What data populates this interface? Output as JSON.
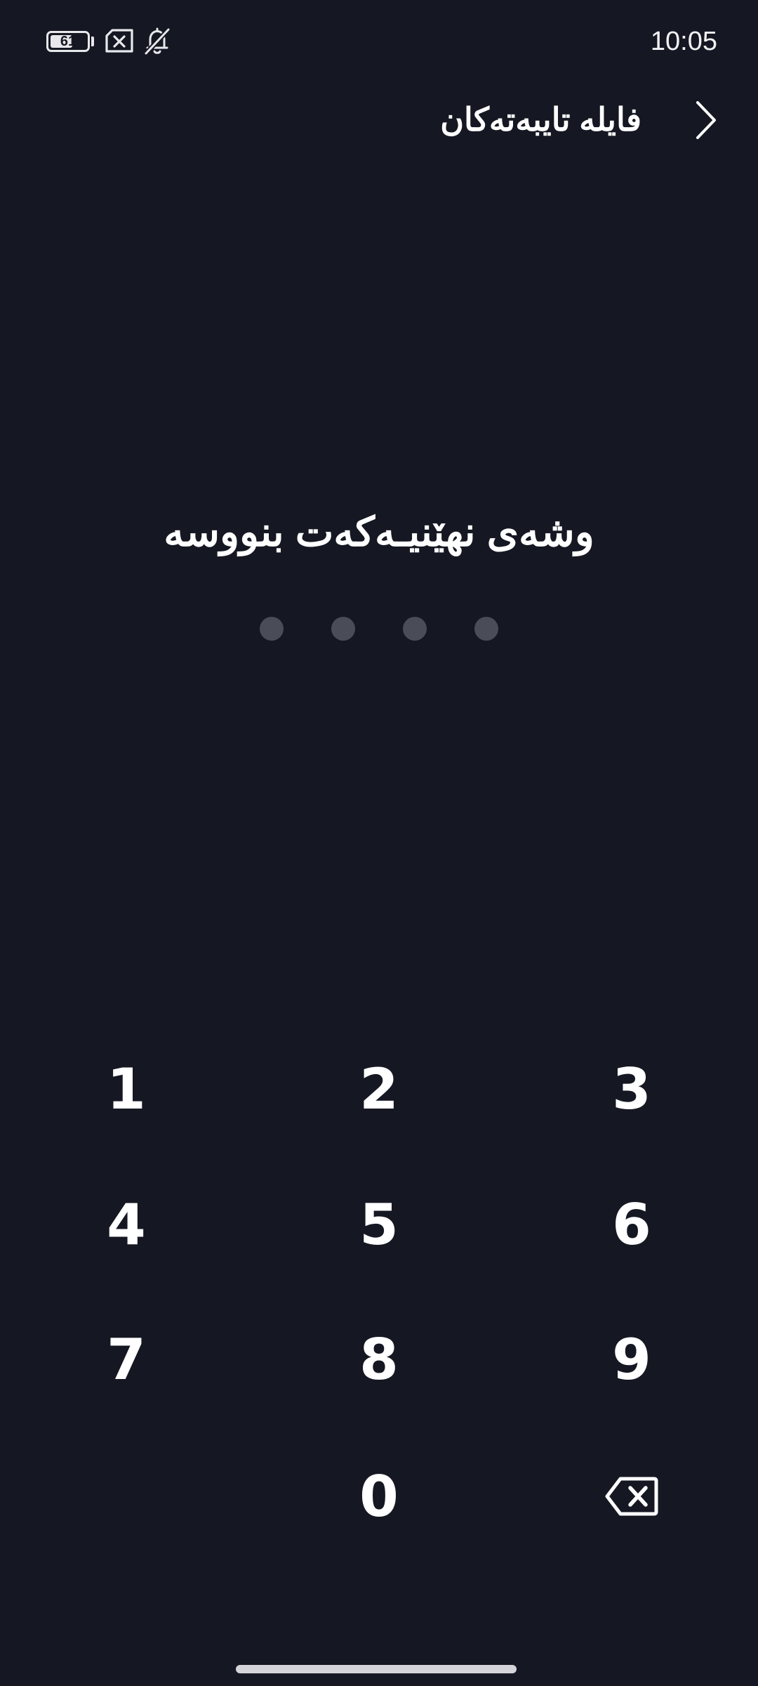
{
  "status_bar": {
    "battery_level": "61",
    "battery_fraction": 0.61,
    "clock": "10:05",
    "icons": [
      "battery-icon",
      "no-sim-icon",
      "notifications-off-icon"
    ]
  },
  "header": {
    "title": "فایلە تایبەتەکان",
    "back_icon": "chevron-right-icon"
  },
  "prompt": {
    "text": "وشەی نهێنیـەکەت بنووسە"
  },
  "pin": {
    "length": 4,
    "entered": 0
  },
  "keypad": {
    "keys": {
      "k1": "1",
      "k2": "2",
      "k3": "3",
      "k4": "4",
      "k5": "5",
      "k6": "6",
      "k7": "7",
      "k8": "8",
      "k9": "9",
      "k0": "0"
    },
    "backspace_icon": "backspace-icon"
  },
  "colors": {
    "background": "#151722",
    "text": "#ffffff",
    "dot_empty": "#4a4c58"
  }
}
